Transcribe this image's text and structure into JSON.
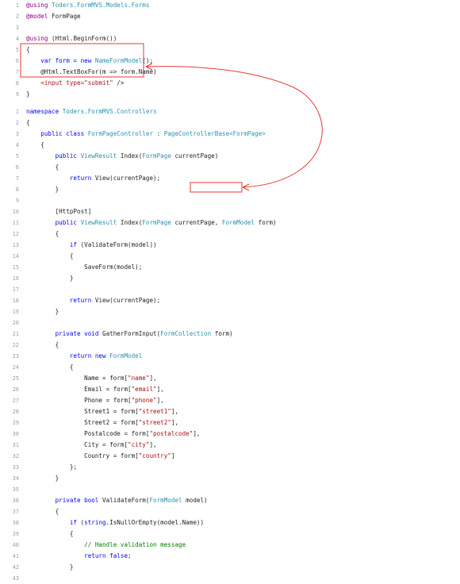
{
  "colors": {
    "keyword": "#0000ff",
    "type": "#2b91af",
    "string": "#a31515",
    "comment": "#008000",
    "razor": "#8b008b",
    "annotation": "#e53935",
    "line_number": "#9aa0a6"
  },
  "view_block": {
    "lines": [
      {
        "n": "1",
        "segs": [
          {
            "t": "@using ",
            "c": "mg"
          },
          {
            "t": "Toders.FormMVS.Models.Forms",
            "c": "ty"
          }
        ]
      },
      {
        "n": "2",
        "segs": [
          {
            "t": "@model ",
            "c": "mg"
          },
          {
            "t": "FormPage",
            "c": ""
          }
        ]
      },
      {
        "n": "3",
        "segs": []
      },
      {
        "n": "4",
        "segs": [
          {
            "t": "@using ",
            "c": "mg"
          },
          {
            "t": "(Html.BeginForm())",
            "c": ""
          }
        ]
      },
      {
        "n": "5",
        "segs": [
          {
            "t": "{",
            "c": ""
          }
        ]
      },
      {
        "n": "6",
        "segs": [
          {
            "t": "    var form = new ",
            "c": "kw"
          },
          {
            "t": "NameFormModel",
            "c": "ty"
          },
          {
            "t": "();",
            "c": ""
          }
        ]
      },
      {
        "n": "7",
        "segs": [
          {
            "t": "    @Html.TextBoxFor(m => form.Name)",
            "c": ""
          }
        ]
      },
      {
        "n": "8",
        "segs": [
          {
            "t": "    <input type=",
            "c": "str"
          },
          {
            "t": "\"submit\"",
            "c": "str"
          },
          {
            "t": " />",
            "c": ""
          }
        ]
      },
      {
        "n": "9",
        "segs": [
          {
            "t": "}",
            "c": ""
          }
        ]
      }
    ]
  },
  "controller_block": {
    "lines": [
      {
        "n": "1",
        "segs": [
          {
            "t": "namespace ",
            "c": "kw"
          },
          {
            "t": "Toders.FormMVS.Controllers",
            "c": "ty"
          }
        ]
      },
      {
        "n": "2",
        "segs": [
          {
            "t": "{",
            "c": ""
          }
        ]
      },
      {
        "n": "3",
        "segs": [
          {
            "t": "    public class ",
            "c": "kw"
          },
          {
            "t": "FormPageController",
            "c": "ty"
          },
          {
            "t": " : ",
            "c": ""
          },
          {
            "t": "PageControllerBase<FormPage>",
            "c": "ty"
          }
        ]
      },
      {
        "n": "4",
        "segs": [
          {
            "t": "    {",
            "c": ""
          }
        ]
      },
      {
        "n": "5",
        "segs": [
          {
            "t": "        public ",
            "c": "kw"
          },
          {
            "t": "ViewResult ",
            "c": "ty"
          },
          {
            "t": "Index(",
            "c": ""
          },
          {
            "t": "FormPage ",
            "c": "ty"
          },
          {
            "t": "currentPage)",
            "c": ""
          }
        ]
      },
      {
        "n": "6",
        "segs": [
          {
            "t": "        {",
            "c": ""
          }
        ]
      },
      {
        "n": "7",
        "segs": [
          {
            "t": "            return ",
            "c": "kw"
          },
          {
            "t": "View(currentPage);",
            "c": ""
          }
        ]
      },
      {
        "n": "8",
        "segs": [
          {
            "t": "        }",
            "c": ""
          }
        ]
      },
      {
        "n": "9",
        "segs": []
      },
      {
        "n": "10",
        "segs": [
          {
            "t": "        [HttpPost]",
            "c": ""
          }
        ]
      },
      {
        "n": "11",
        "segs": [
          {
            "t": "        public ",
            "c": "kw"
          },
          {
            "t": "ViewResult ",
            "c": "ty"
          },
          {
            "t": "Index(",
            "c": ""
          },
          {
            "t": "FormPage ",
            "c": "ty"
          },
          {
            "t": "currentPage, ",
            "c": ""
          },
          {
            "t": "FormModel ",
            "c": "ty"
          },
          {
            "t": "form)",
            "c": ""
          }
        ]
      },
      {
        "n": "12",
        "segs": [
          {
            "t": "        {",
            "c": ""
          }
        ]
      },
      {
        "n": "13",
        "segs": [
          {
            "t": "            if ",
            "c": "kw"
          },
          {
            "t": "(ValidateForm(model))",
            "c": ""
          }
        ]
      },
      {
        "n": "14",
        "segs": [
          {
            "t": "            {",
            "c": ""
          }
        ]
      },
      {
        "n": "15",
        "segs": [
          {
            "t": "                SaveForm(model);",
            "c": ""
          }
        ]
      },
      {
        "n": "16",
        "segs": [
          {
            "t": "            }",
            "c": ""
          }
        ]
      },
      {
        "n": "17",
        "segs": []
      },
      {
        "n": "18",
        "segs": [
          {
            "t": "            return ",
            "c": "kw"
          },
          {
            "t": "View(currentPage);",
            "c": ""
          }
        ]
      },
      {
        "n": "19",
        "segs": [
          {
            "t": "        }",
            "c": ""
          }
        ]
      },
      {
        "n": "20",
        "segs": []
      },
      {
        "n": "21",
        "segs": [
          {
            "t": "        private void ",
            "c": "kw"
          },
          {
            "t": "GatherFormInput(",
            "c": ""
          },
          {
            "t": "FormCollection ",
            "c": "ty"
          },
          {
            "t": "form)",
            "c": ""
          }
        ]
      },
      {
        "n": "22",
        "segs": [
          {
            "t": "        {",
            "c": ""
          }
        ]
      },
      {
        "n": "23",
        "segs": [
          {
            "t": "            return new ",
            "c": "kw"
          },
          {
            "t": "FormModel",
            "c": "ty"
          }
        ]
      },
      {
        "n": "24",
        "segs": [
          {
            "t": "            {",
            "c": ""
          }
        ]
      },
      {
        "n": "25",
        "segs": [
          {
            "t": "                Name = form[",
            "c": ""
          },
          {
            "t": "\"name\"",
            "c": "str"
          },
          {
            "t": "],",
            "c": ""
          }
        ]
      },
      {
        "n": "26",
        "segs": [
          {
            "t": "                Email = form[",
            "c": ""
          },
          {
            "t": "\"email\"",
            "c": "str"
          },
          {
            "t": "],",
            "c": ""
          }
        ]
      },
      {
        "n": "27",
        "segs": [
          {
            "t": "                Phone = form[",
            "c": ""
          },
          {
            "t": "\"phone\"",
            "c": "str"
          },
          {
            "t": "],",
            "c": ""
          }
        ]
      },
      {
        "n": "28",
        "segs": [
          {
            "t": "                Street1 = form[",
            "c": ""
          },
          {
            "t": "\"street1\"",
            "c": "str"
          },
          {
            "t": "],",
            "c": ""
          }
        ]
      },
      {
        "n": "29",
        "segs": [
          {
            "t": "                Street2 = form[",
            "c": ""
          },
          {
            "t": "\"street2\"",
            "c": "str"
          },
          {
            "t": "],",
            "c": ""
          }
        ]
      },
      {
        "n": "30",
        "segs": [
          {
            "t": "                Postalcode = form[",
            "c": ""
          },
          {
            "t": "\"postalcode\"",
            "c": "str"
          },
          {
            "t": "],",
            "c": ""
          }
        ]
      },
      {
        "n": "31",
        "segs": [
          {
            "t": "                City = form[",
            "c": ""
          },
          {
            "t": "\"city\"",
            "c": "str"
          },
          {
            "t": "],",
            "c": ""
          }
        ]
      },
      {
        "n": "32",
        "segs": [
          {
            "t": "                Country = form[",
            "c": ""
          },
          {
            "t": "\"country\"",
            "c": "str"
          },
          {
            "t": "]",
            "c": ""
          }
        ]
      },
      {
        "n": "33",
        "segs": [
          {
            "t": "            };",
            "c": ""
          }
        ]
      },
      {
        "n": "34",
        "segs": [
          {
            "t": "        }",
            "c": ""
          }
        ]
      },
      {
        "n": "35",
        "segs": []
      },
      {
        "n": "36",
        "segs": [
          {
            "t": "        private bool ",
            "c": "kw"
          },
          {
            "t": "ValidateForm(",
            "c": ""
          },
          {
            "t": "FormModel ",
            "c": "ty"
          },
          {
            "t": "model)",
            "c": ""
          }
        ]
      },
      {
        "n": "37",
        "segs": [
          {
            "t": "        {",
            "c": ""
          }
        ]
      },
      {
        "n": "38",
        "segs": [
          {
            "t": "            if ",
            "c": "kw"
          },
          {
            "t": "(",
            "c": ""
          },
          {
            "t": "string",
            "c": "kw"
          },
          {
            "t": ".IsNullOrEmpty(model.Name))",
            "c": ""
          }
        ]
      },
      {
        "n": "39",
        "segs": [
          {
            "t": "            {",
            "c": ""
          }
        ]
      },
      {
        "n": "40",
        "segs": [
          {
            "t": "                // Handle validation message",
            "c": "cm"
          }
        ]
      },
      {
        "n": "41",
        "segs": [
          {
            "t": "                return false",
            "c": "kw"
          },
          {
            "t": ";",
            "c": ""
          }
        ]
      },
      {
        "n": "42",
        "segs": [
          {
            "t": "            }",
            "c": ""
          }
        ]
      },
      {
        "n": "43",
        "segs": []
      }
    ]
  }
}
